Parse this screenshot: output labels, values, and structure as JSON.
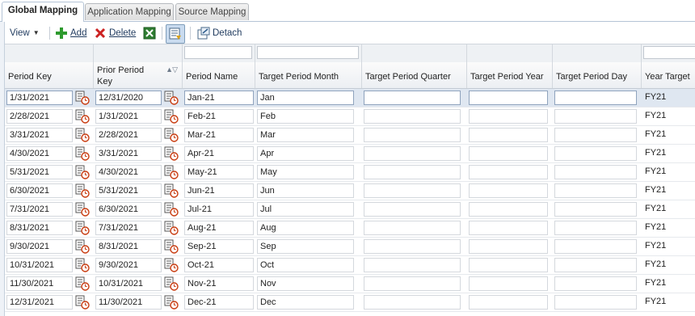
{
  "tabs": [
    {
      "label": "Global Mapping"
    },
    {
      "label": "Application Mapping"
    },
    {
      "label": "Source Mapping"
    }
  ],
  "toolbar": {
    "view_label": "View",
    "add_label": "Add",
    "delete_label": "Delete",
    "detach_label": "Detach"
  },
  "colors": {
    "accent": "#b5c4d6",
    "selected_row": "#dfe7f1",
    "add_icon": "#2e9a2e",
    "delete_icon": "#cc2222"
  },
  "table": {
    "columns": [
      {
        "label": "Period Key"
      },
      {
        "label": "Prior Period Key"
      },
      {
        "label": "Period Name"
      },
      {
        "label": "Target Period Month"
      },
      {
        "label": "Target Period Quarter"
      },
      {
        "label": "Target Period Year"
      },
      {
        "label": "Target Period Day"
      },
      {
        "label": "Year Target"
      }
    ],
    "rows": [
      {
        "key": "1/31/2021",
        "prior": "12/31/2020",
        "name": "Jan-21",
        "month": "Jan",
        "quarter": "",
        "year": "",
        "day": "",
        "year_target": "FY21"
      },
      {
        "key": "2/28/2021",
        "prior": "1/31/2021",
        "name": "Feb-21",
        "month": "Feb",
        "quarter": "",
        "year": "",
        "day": "",
        "year_target": "FY21"
      },
      {
        "key": "3/31/2021",
        "prior": "2/28/2021",
        "name": "Mar-21",
        "month": "Mar",
        "quarter": "",
        "year": "",
        "day": "",
        "year_target": "FY21"
      },
      {
        "key": "4/30/2021",
        "prior": "3/31/2021",
        "name": "Apr-21",
        "month": "Apr",
        "quarter": "",
        "year": "",
        "day": "",
        "year_target": "FY21"
      },
      {
        "key": "5/31/2021",
        "prior": "4/30/2021",
        "name": "May-21",
        "month": "May",
        "quarter": "",
        "year": "",
        "day": "",
        "year_target": "FY21"
      },
      {
        "key": "6/30/2021",
        "prior": "5/31/2021",
        "name": "Jun-21",
        "month": "Jun",
        "quarter": "",
        "year": "",
        "day": "",
        "year_target": "FY21"
      },
      {
        "key": "7/31/2021",
        "prior": "6/30/2021",
        "name": "Jul-21",
        "month": "Jul",
        "quarter": "",
        "year": "",
        "day": "",
        "year_target": "FY21"
      },
      {
        "key": "8/31/2021",
        "prior": "7/31/2021",
        "name": "Aug-21",
        "month": "Aug",
        "quarter": "",
        "year": "",
        "day": "",
        "year_target": "FY21"
      },
      {
        "key": "9/30/2021",
        "prior": "8/31/2021",
        "name": "Sep-21",
        "month": "Sep",
        "quarter": "",
        "year": "",
        "day": "",
        "year_target": "FY21"
      },
      {
        "key": "10/31/2021",
        "prior": "9/30/2021",
        "name": "Oct-21",
        "month": "Oct",
        "quarter": "",
        "year": "",
        "day": "",
        "year_target": "FY21"
      },
      {
        "key": "11/30/2021",
        "prior": "10/31/2021",
        "name": "Nov-21",
        "month": "Nov",
        "quarter": "",
        "year": "",
        "day": "",
        "year_target": "FY21"
      },
      {
        "key": "12/31/2021",
        "prior": "11/30/2021",
        "name": "Dec-21",
        "month": "Dec",
        "quarter": "",
        "year": "",
        "day": "",
        "year_target": "FY21"
      }
    ]
  }
}
